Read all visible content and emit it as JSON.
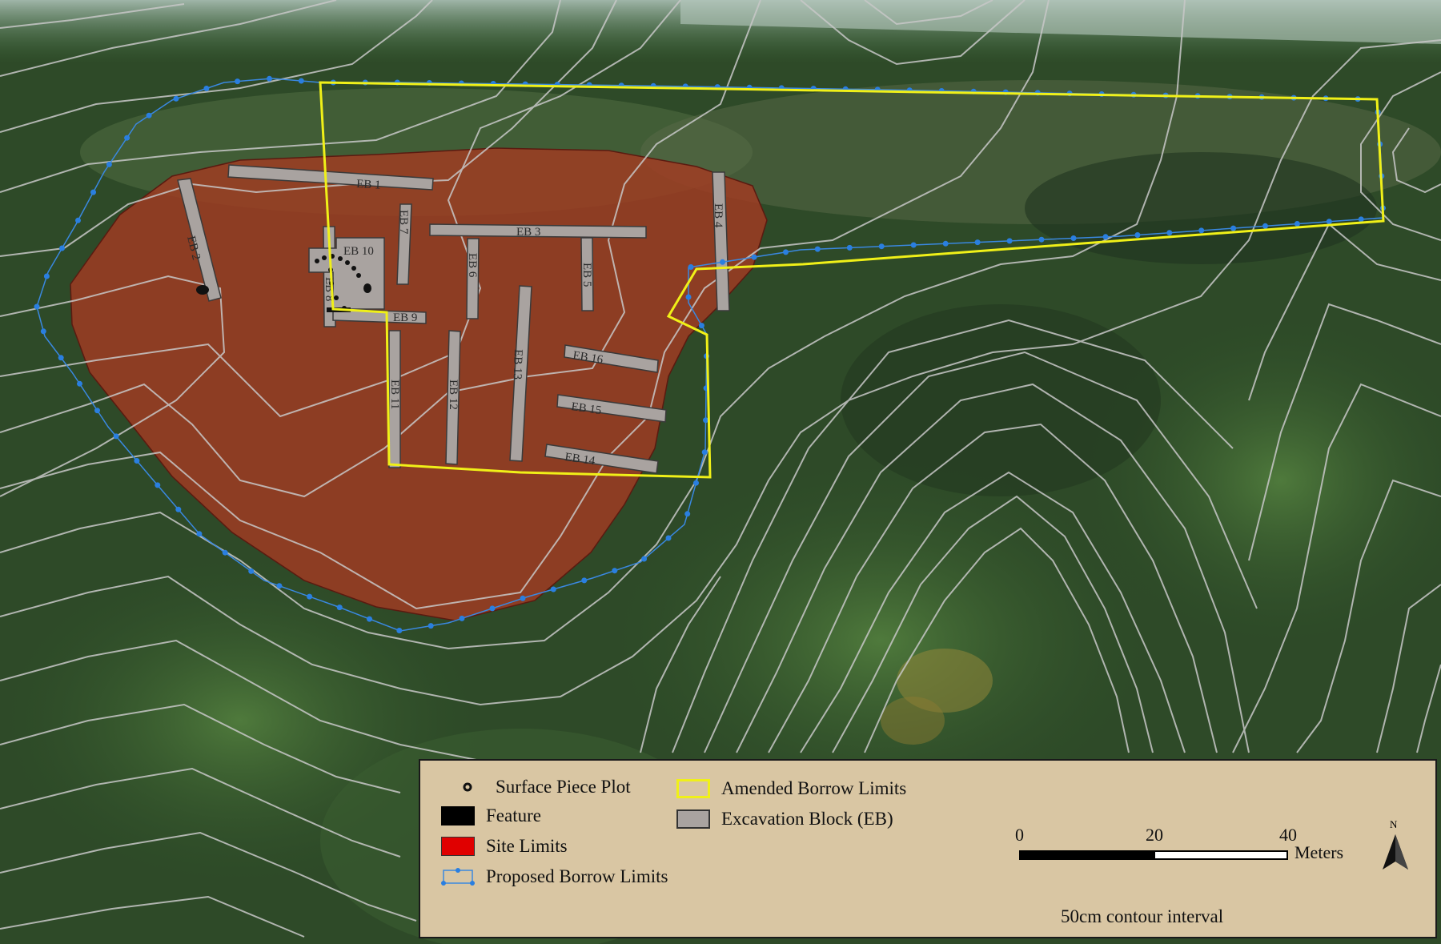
{
  "map": {
    "excavation_blocks": [
      "EB 1",
      "EB 2",
      "EB 3",
      "EB 4",
      "EB 5",
      "EB 6",
      "EB 7",
      "EB 8",
      "EB 9",
      "EB 10",
      "EB 11",
      "EB 12",
      "EB 13",
      "EB 14",
      "EB 15",
      "EB 16"
    ],
    "colors": {
      "site_limits": "#a23a22",
      "excavation_block": "#a9a3a0",
      "amended_borrow": "#f0f018",
      "proposed_borrow": "#2a7fe0",
      "contour": "#c8c8c8",
      "legend_bg": "#d9c6a3"
    }
  },
  "legend": {
    "items": {
      "surface_piece_plot": "Surface Piece Plot",
      "feature": "Feature",
      "site_limits": "Site Limits",
      "proposed_borrow_limits": "Proposed Borrow Limits",
      "amended_borrow_limits": "Amended Borrow Limits",
      "excavation_block": "Excavation Block (EB)"
    },
    "scale": {
      "ticks": [
        "0",
        "20",
        "40"
      ],
      "unit": "Meters"
    },
    "north": "N",
    "contour_interval": "50cm contour interval"
  }
}
